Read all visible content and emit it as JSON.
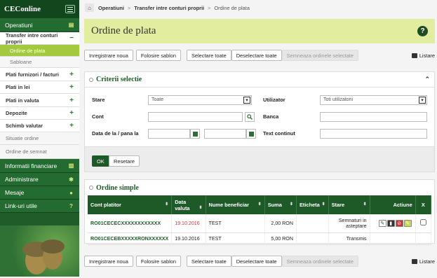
{
  "sidebar": {
    "logo": "CEConline",
    "items": [
      {
        "label": "Operatiuni",
        "type": "g"
      },
      {
        "label": "Transfer intre conturi proprii",
        "type": "w",
        "mark": "−"
      },
      {
        "label": "Ordine de plata",
        "type": "a"
      },
      {
        "label": "Sabloane",
        "type": "sg"
      },
      {
        "label": "Plati furnizori / facturi",
        "type": "w",
        "mark": "+"
      },
      {
        "label": "Plati in lei",
        "type": "w",
        "mark": "+"
      },
      {
        "label": "Plati in valuta",
        "type": "w",
        "mark": "+"
      },
      {
        "label": "Depozite",
        "type": "w",
        "mark": "+"
      },
      {
        "label": "Schimb valutar",
        "type": "w",
        "mark": "+"
      },
      {
        "label": "Situatie ordine",
        "type": "gr"
      },
      {
        "label": "Ordine de semnat",
        "type": "gr"
      },
      {
        "label": "Informatii financiare",
        "type": "g"
      },
      {
        "label": "Administrare",
        "type": "g"
      },
      {
        "label": "Mesaje",
        "type": "g"
      },
      {
        "label": "Link-uri utile",
        "type": "g"
      }
    ]
  },
  "breadcrumb": {
    "l1": "Operatiuni",
    "l2": "Transfer intre conturi proprii",
    "l3": "Ordine de plata"
  },
  "page_title": "Ordine de plata",
  "toolbar": {
    "new": "Inregistrare noua",
    "tpl": "Folosire sablon",
    "sel": "Selectare toate",
    "desel": "Deselectare toate",
    "sign": "Semneaza ordinele selectate",
    "list": "Listare"
  },
  "criteria": {
    "title": "Criterii selectie",
    "stare": "Stare",
    "stare_val": "Toate",
    "util": "Utilizator",
    "util_val": "Toti utilizatorii",
    "cont": "Cont",
    "banca": "Banca",
    "data": "Data de la / pana la",
    "text": "Text continut",
    "ok": "OK",
    "reset": "Resetare"
  },
  "orders": {
    "title": "Ordine simple",
    "cols": [
      "Cont platitor",
      "Data valuta",
      "Nume beneficiar",
      "Suma",
      "Eticheta",
      "Stare",
      "Actiune",
      "X"
    ],
    "rows": [
      {
        "cont": "RO01CECECXXXXXXXXXXXX",
        "data": "19.10.2016",
        "ben": "TEST",
        "suma": "2,00 RON",
        "etic": "",
        "stare": "Semnaturi in asteptare",
        "red": true
      },
      {
        "cont": "RO01CECEBXXXXXRONXXXXXX",
        "data": "19.10.2016",
        "ben": "TEST",
        "suma": "5,00 RON",
        "etic": "",
        "stare": "Transmis",
        "red": false
      }
    ]
  }
}
